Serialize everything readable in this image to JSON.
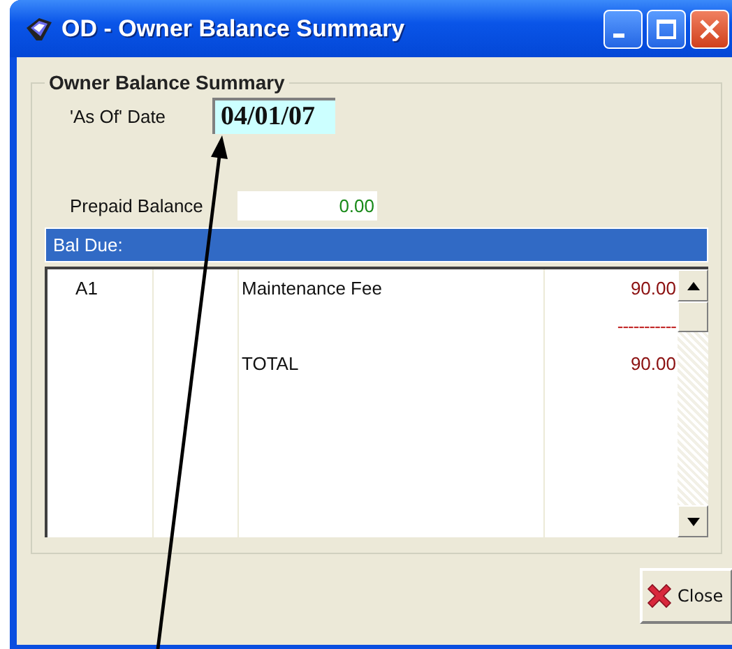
{
  "window": {
    "title": "OD - Owner Balance Summary"
  },
  "group": {
    "title": "Owner Balance Summary"
  },
  "as_of_date": {
    "label": "'As Of' Date",
    "value": "04/01/07"
  },
  "prepaid_balance": {
    "label": "Prepaid Balance",
    "value": "0.00"
  },
  "bal_due": {
    "title": "Bal Due:",
    "rows": [
      {
        "kind": "item",
        "column_1": "A1",
        "column_3": "Maintenance Fee",
        "column_4": "90.00"
      },
      {
        "kind": "rule",
        "column_4": "-----------"
      },
      {
        "kind": "total",
        "column_3": "TOTAL",
        "column_4": "90.00"
      }
    ]
  },
  "buttons": [
    {
      "label": "Close"
    }
  ]
}
